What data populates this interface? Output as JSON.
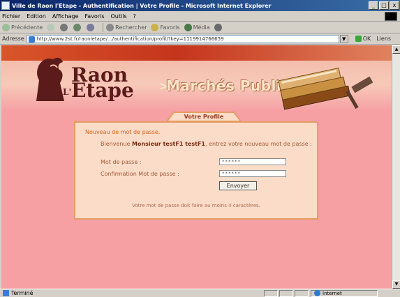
{
  "window": {
    "title": "Ville de Raon l'Etape - Authentification | Votre Profile - Microsoft Internet Explorer",
    "minimize": "_",
    "maximize": "□",
    "close": "x"
  },
  "menu": [
    "Fichier",
    "Edition",
    "Affichage",
    "Favoris",
    "Outils",
    "?"
  ],
  "toolbar": {
    "back": "Précédente",
    "search": "Rechercher",
    "favorites": "Favoris",
    "media": "Média"
  },
  "address": {
    "label": "Adresse",
    "url": "http://www.2st.fr/raonletape/.../authentification/profil/?key=1119914766659",
    "go": "OK",
    "links": "Liens"
  },
  "banner": {
    "logo_line1": "Raon",
    "logo_prefix": "L'",
    "logo_line2": "Etape",
    "title": "Marchés Publics",
    "arrow": ">"
  },
  "profile": {
    "tab_label": "Votre Profile",
    "heading": "Nouveau de mot de passe.",
    "intro_prefix": "Bienvenue",
    "intro_name": "Monsieur testF1 testF1",
    "intro_suffix": ", entrez votre nouveau mot de passe :",
    "password_label": "Mot de passe :",
    "password_value": "******",
    "confirm_label": "Confirmation Mot de passe :",
    "confirm_value": "******",
    "submit_label": "Envoyer",
    "hint": "Votre mot de passe doit faire au moins 4 caractères."
  },
  "status": {
    "text": "Terminé",
    "zone": "Internet"
  }
}
